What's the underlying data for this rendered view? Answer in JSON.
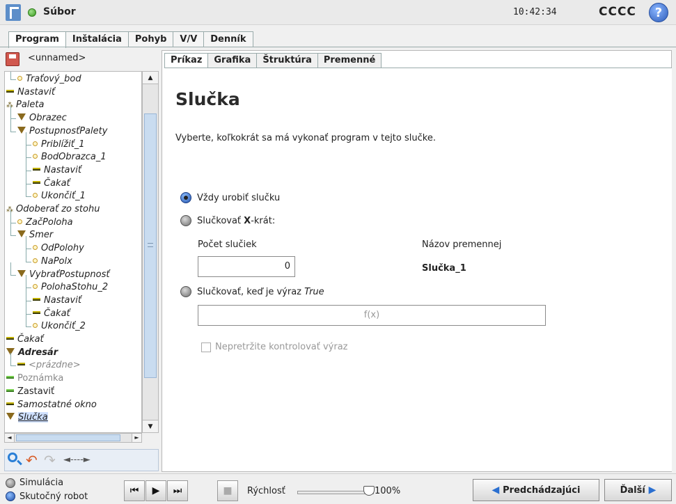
{
  "topbar": {
    "file_label": "Súbor",
    "time": "10:42:34",
    "robot_name": "CCCC",
    "help_symbol": "?"
  },
  "main_tabs": [
    "Program",
    "Inštalácia",
    "Pohyb",
    "V/V",
    "Denník"
  ],
  "program": {
    "name": "<unnamed>"
  },
  "tree": [
    {
      "label": "Traťový_bod",
      "marker": "dot",
      "indent": 1,
      "style": "italic"
    },
    {
      "label": "Nastaviť",
      "marker": "bar",
      "indent": 0,
      "style": "italic"
    },
    {
      "label": "Paleta",
      "marker": "pal",
      "indent": 0,
      "style": "italic"
    },
    {
      "label": "Obrazec",
      "marker": "tri",
      "indent": 1,
      "style": "italic"
    },
    {
      "label": "PostupnosťPalety",
      "marker": "tri",
      "indent": 1,
      "style": "italic"
    },
    {
      "label": "Priblížiť_1",
      "marker": "dot",
      "indent": 2,
      "style": "italic"
    },
    {
      "label": "BodObrazca_1",
      "marker": "dot",
      "indent": 2,
      "style": "italic"
    },
    {
      "label": "Nastaviť",
      "marker": "bar",
      "indent": 2,
      "style": "italic"
    },
    {
      "label": "Čakať",
      "marker": "bar",
      "indent": 2,
      "style": "italic"
    },
    {
      "label": "Ukončiť_1",
      "marker": "dot",
      "indent": 2,
      "style": "italic"
    },
    {
      "label": "Odoberať zo stohu",
      "marker": "pal",
      "indent": 0,
      "style": "italic"
    },
    {
      "label": "ZačPoloha",
      "marker": "dot",
      "indent": 1,
      "style": "italic"
    },
    {
      "label": "Smer",
      "marker": "tri",
      "indent": 1,
      "style": "italic"
    },
    {
      "label": "OdPolohy",
      "marker": "dot",
      "indent": 2,
      "style": "italic"
    },
    {
      "label": "NaPolx",
      "marker": "dot",
      "indent": 2,
      "style": "italic"
    },
    {
      "label": "VybraťPostupnosť",
      "marker": "tri",
      "indent": 1,
      "style": "italic"
    },
    {
      "label": "PolohaStohu_2",
      "marker": "dot",
      "indent": 2,
      "style": "italic"
    },
    {
      "label": "Nastaviť",
      "marker": "bar",
      "indent": 2,
      "style": "italic"
    },
    {
      "label": "Čakať",
      "marker": "bar",
      "indent": 2,
      "style": "italic"
    },
    {
      "label": "Ukončiť_2",
      "marker": "dot",
      "indent": 2,
      "style": "italic"
    },
    {
      "label": "Čakať",
      "marker": "bar",
      "indent": 0,
      "style": "italic"
    },
    {
      "label": "Adresár",
      "marker": "tri",
      "indent": 0,
      "style": "bold"
    },
    {
      "label": "<prázdne>",
      "marker": "bar",
      "indent": 1,
      "style": "grey"
    },
    {
      "label": "Poznámka",
      "marker": "greenbar",
      "indent": 0,
      "style": "grey-plain"
    },
    {
      "label": "Zastaviť",
      "marker": "greenbar",
      "indent": 0,
      "style": "plain"
    },
    {
      "label": "Samostatné okno",
      "marker": "bar",
      "indent": 0,
      "style": "italic"
    },
    {
      "label": "Slučka",
      "marker": "tri",
      "indent": 0,
      "style": "selected"
    }
  ],
  "tree_tools": {
    "move_label": "◄----►"
  },
  "sub_tabs": [
    "Príkaz",
    "Grafika",
    "Štruktúra",
    "Premenné"
  ],
  "loop": {
    "title": "Slučka",
    "description": "Vyberte, koľkokrát sa má vykonať program v tejto slučke.",
    "option_always": "Vždy urobiť slučku",
    "option_times_prefix": "Slučkovať ",
    "option_times_bold": "X",
    "option_times_suffix": "-krát:",
    "count_label": "Počet slučiek",
    "var_label": "Názov premennej",
    "count_value": "0",
    "var_name": "Slučka_1",
    "option_expr_prefix": "Slučkovať, keď je výraz ",
    "option_expr_italic": "True",
    "expr_placeholder": "f(x)",
    "continuous_check": "Nepretržite kontrolovať výraz"
  },
  "bottom": {
    "sim_label": "Simulácia",
    "real_label": "Skutočný robot",
    "speed_label": "Rýchlosť",
    "speed_value": "100%",
    "speed_fraction": 1.0,
    "prev_label": "Predchádzajúci",
    "next_label": "Ďalší"
  }
}
